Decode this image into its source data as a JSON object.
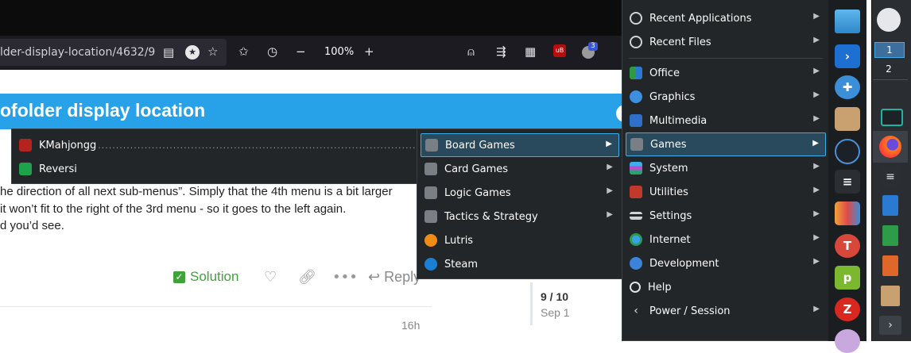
{
  "browser": {
    "url": "lder-display-location/4632/9",
    "zoom": "100%",
    "badge_count": "3",
    "badge_color": "#3a56d8"
  },
  "page": {
    "banner_title": "ofolder display location",
    "banner_color": "#27a2e8",
    "lines": [
      "he direction of all next sub-menus”. Simply that the 4th menu is a bit larger",
      "it won’t fit to the right of the 3rd menu - so it goes to the left again.",
      "d you’d see."
    ],
    "solution_label": "Solution",
    "reply_label": "Reply",
    "post_age": "16h",
    "timeline_count": "9 / 10",
    "timeline_date": "Sep 1"
  },
  "menus": {
    "board_games": [
      {
        "label": "KMahjongg",
        "icon": "mahjongg-icon",
        "color": "#b5231f"
      },
      {
        "label": "Reversi",
        "icon": "reversi-icon",
        "color": "#1fa34a"
      }
    ],
    "games": [
      {
        "label": "Board Games",
        "icon": "gamepad-icon",
        "submenu": true,
        "highlighted": true
      },
      {
        "label": "Card Games",
        "icon": "gamepad-icon",
        "submenu": true
      },
      {
        "label": "Logic Games",
        "icon": "gamepad-icon",
        "submenu": true
      },
      {
        "label": "Tactics & Strategy",
        "icon": "gamepad-icon",
        "submenu": true
      },
      {
        "label": "Lutris",
        "icon": "lutris-icon",
        "submenu": false
      },
      {
        "label": "Steam",
        "icon": "steam-icon",
        "submenu": false
      }
    ],
    "main_top": [
      {
        "label": "Recent Applications",
        "icon": "clock-icon"
      },
      {
        "label": "Recent Files",
        "icon": "clock-icon"
      }
    ],
    "main": [
      {
        "label": "Office",
        "icon": "office-icon",
        "submenu": true
      },
      {
        "label": "Graphics",
        "icon": "graphics-icon",
        "submenu": true
      },
      {
        "label": "Multimedia",
        "icon": "multimedia-icon",
        "submenu": true
      },
      {
        "label": "Games",
        "icon": "gamepad-icon",
        "submenu": true,
        "highlighted": true
      },
      {
        "label": "System",
        "icon": "system-icon",
        "submenu": true
      },
      {
        "label": "Utilities",
        "icon": "utilities-icon",
        "submenu": true
      },
      {
        "label": "Settings",
        "icon": "settings-icon",
        "submenu": true
      },
      {
        "label": "Internet",
        "icon": "globe-icon",
        "submenu": true
      },
      {
        "label": "Development",
        "icon": "development-icon",
        "submenu": true
      },
      {
        "label": "Help",
        "icon": "help-icon",
        "submenu": false
      },
      {
        "label": "Power / Session",
        "icon": "chevron-left-icon",
        "submenu": true
      }
    ]
  },
  "pager": {
    "desktop1": "1",
    "desktop2": "2"
  },
  "colors": {
    "menu_bg": "#232629",
    "highlight": "#3daee9"
  }
}
